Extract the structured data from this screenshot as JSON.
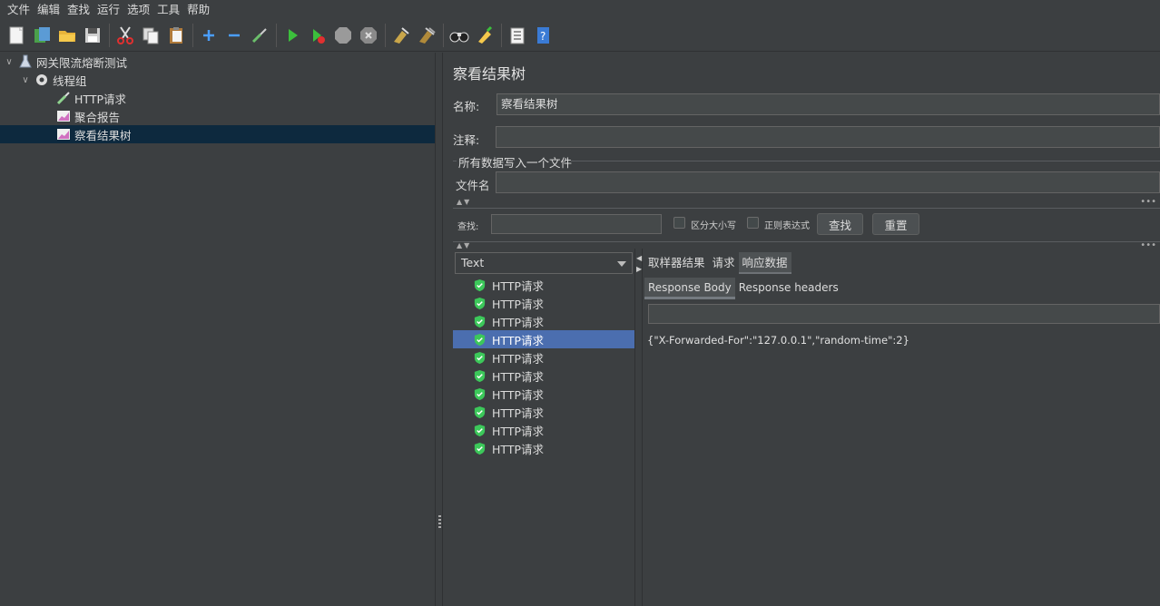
{
  "menu": [
    "文件",
    "编辑",
    "查找",
    "运行",
    "选项",
    "工具",
    "帮助"
  ],
  "tree": {
    "root": "网关限流熔断测试",
    "thread_group": "线程组",
    "items": [
      "HTTP请求",
      "聚合报告",
      "察看结果树"
    ]
  },
  "panel": {
    "title": "察看结果树",
    "name_label": "名称:",
    "name_value": "察看结果树",
    "comment_label": "注释:",
    "group_label": "所有数据写入一个文件",
    "filename_label": "文件名"
  },
  "search": {
    "label": "查找:",
    "case_label": "区分大小写",
    "regex_label": "正则表达式",
    "find_button": "查找",
    "reset_button": "重置"
  },
  "renderer": {
    "selected": "Text"
  },
  "results": [
    "HTTP请求",
    "HTTP请求",
    "HTTP请求",
    "HTTP请求",
    "HTTP请求",
    "HTTP请求",
    "HTTP请求",
    "HTTP请求",
    "HTTP请求",
    "HTTP请求"
  ],
  "tabs": [
    "取样器结果",
    "请求",
    "响应数据"
  ],
  "subtabs": [
    "Response Body",
    "Response headers"
  ],
  "response_body": "{\"X-Forwarded-For\":\"127.0.0.1\",\"random-time\":2}",
  "colors": {
    "selected_row": "#4b6eaf",
    "tree_selected": "#0d293e",
    "success_icon": "#3cc85a"
  }
}
